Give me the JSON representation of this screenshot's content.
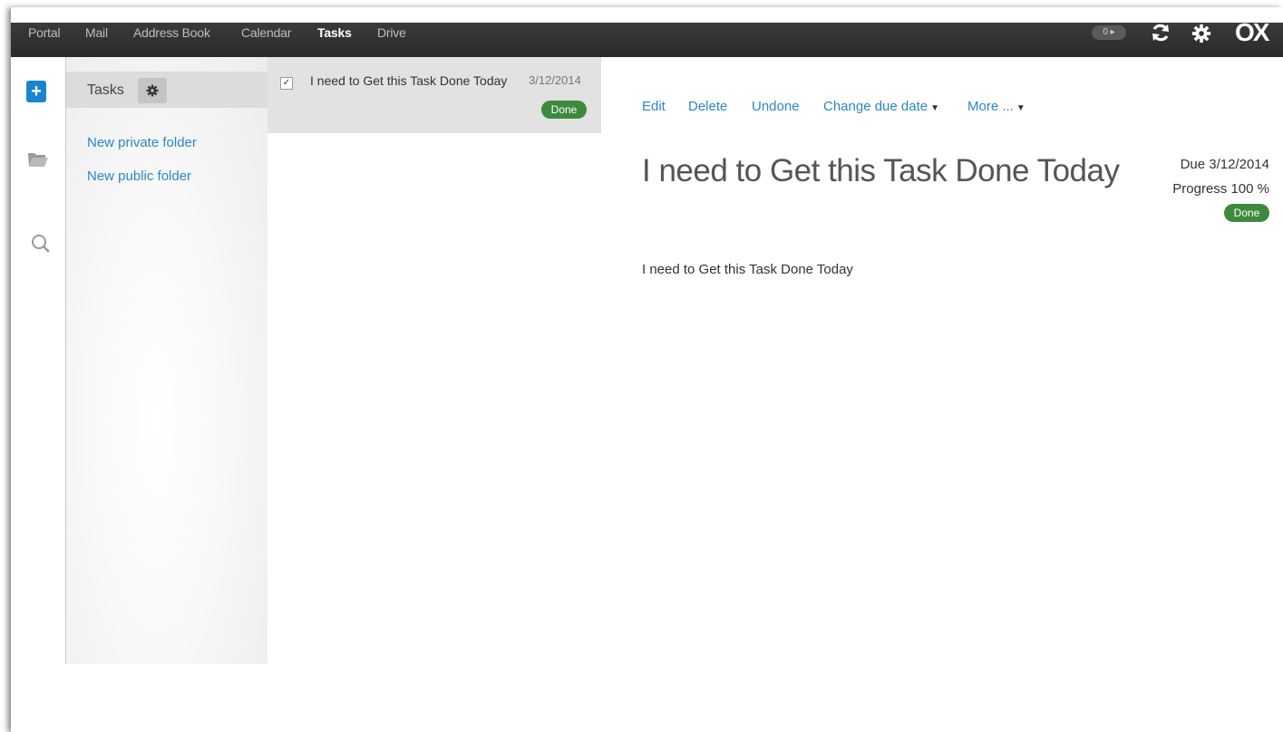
{
  "topbar": {
    "tabs": [
      "Portal",
      "Mail",
      "Address Book",
      "Calendar",
      "Tasks",
      "Drive"
    ],
    "active_tab": "Tasks",
    "notifications": "0 ▸",
    "logo": "OX"
  },
  "sidebar": {
    "folder_label": "Tasks",
    "new_private_folder": "New private folder",
    "new_public_folder": "New public folder"
  },
  "task_list": {
    "items": [
      {
        "title": "I need to Get this Task Done Today",
        "date": "3/12/2014",
        "status": "Done",
        "checked": true
      }
    ]
  },
  "detail": {
    "actions": {
      "edit": "Edit",
      "delete": "Delete",
      "undone": "Undone",
      "change_due_date": "Change due date",
      "more": "More ..."
    },
    "title": "I need to Get this Task Done Today",
    "due": "Due 3/12/2014",
    "progress": "Progress 100 %",
    "status": "Done",
    "note": "I need to Get this Task Done Today"
  },
  "colors": {
    "accent": "#2a87c8",
    "done_badge": "#3d8a3d",
    "topbar": "#2e2e2e"
  }
}
